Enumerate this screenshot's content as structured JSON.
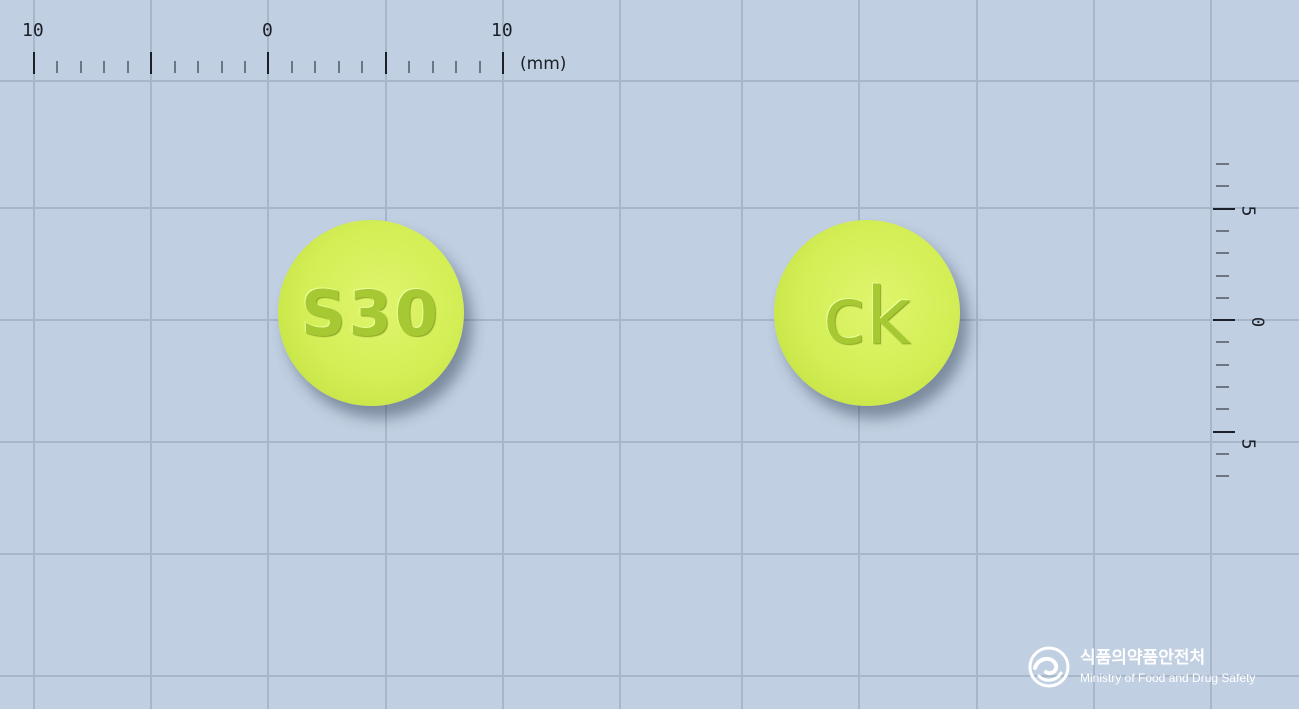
{
  "ruler_top": {
    "labels": [
      "10",
      "0",
      "10"
    ],
    "unit": "(mm)"
  },
  "ruler_side": {
    "labels": [
      "5",
      "0",
      "5"
    ]
  },
  "pills": [
    {
      "imprint": "S30",
      "color": "#d3ee55"
    },
    {
      "imprint": "ck",
      "color": "#d3ee55"
    }
  ],
  "logo": {
    "name_kr": "식품의약품안전처",
    "name_en": "Ministry of Food and Drug Safety"
  },
  "colors": {
    "background": "#c0cfe1",
    "grid": "#a7b6c8",
    "pill": "#d3ee55"
  }
}
